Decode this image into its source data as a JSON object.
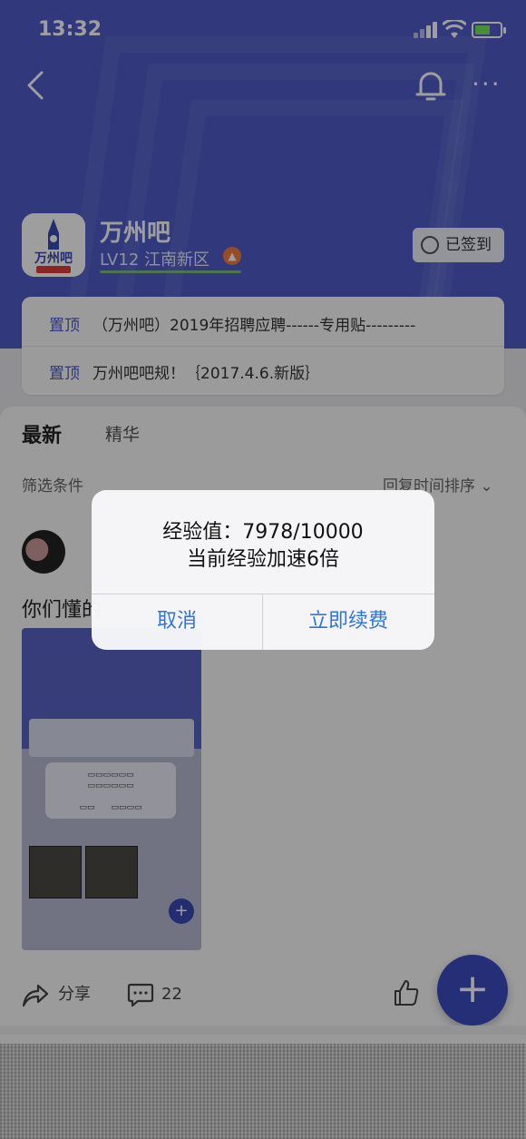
{
  "status_bar": {
    "time": "13:32"
  },
  "forum": {
    "name": "万州吧",
    "level": "LV12 江南新区",
    "signed_label": "已签到"
  },
  "pinned": [
    {
      "tag": "置顶",
      "text": "（万州吧）2019年招聘应聘------专用贴---------"
    },
    {
      "tag": "置顶",
      "text": "万州吧吧规！｛2017.4.6.新版｝"
    }
  ],
  "tabs": {
    "latest": "最新",
    "featured": "精华"
  },
  "filter": {
    "label": "筛选条件",
    "sort": "回复时间排序 ⌄"
  },
  "post": {
    "text_visible": "你们懂的",
    "share_label": "分享",
    "comment_count": "22"
  },
  "dialog": {
    "line1": "经验值：7978/10000",
    "line2": "当前经验加速6倍",
    "cancel": "取消",
    "renew": "立即续费"
  },
  "colors": {
    "brand": "#4f5cc9",
    "link": "#2f74e0",
    "fab": "#3d4cc0"
  }
}
